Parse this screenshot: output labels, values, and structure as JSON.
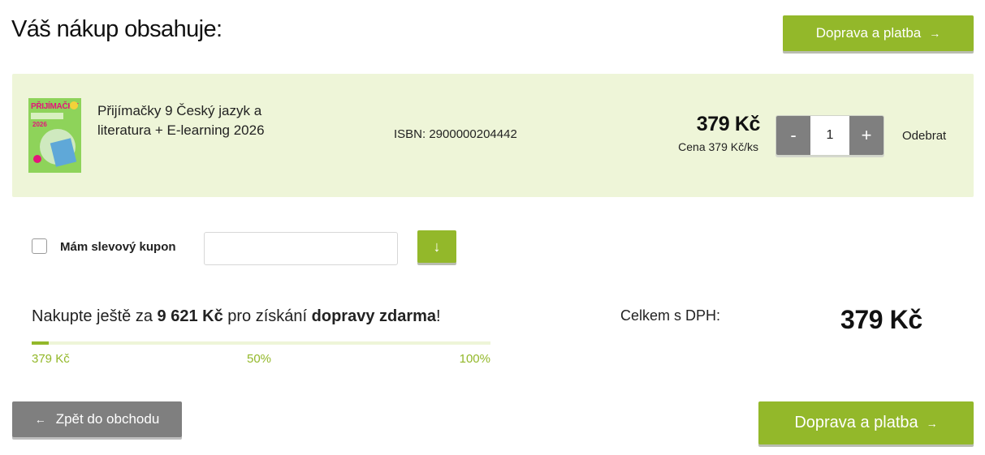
{
  "page": {
    "title": "Váš nákup obsahuje:"
  },
  "actions": {
    "top_cta_label": "Doprava a platba",
    "bottom_cta_label": "Doprava a platba",
    "back_label": "Zpět do obchodu",
    "arrow_right": "→",
    "arrow_left": "←"
  },
  "cart": {
    "items": [
      {
        "name": "Přijímačky 9 Český jazyk a literatura + E-learning 2026",
        "isbn": "ISBN: 2900000204442",
        "price": "379 Kč",
        "unit_price": "Cena 379 Kč/ks",
        "quantity": "1",
        "decrement_label": "-",
        "increment_label": "+",
        "remove_label": "Odebrat",
        "cover_title": "PŘIJÍMAČKY",
        "cover_year": "2026"
      }
    ]
  },
  "coupon": {
    "label": "Mám slevový kupon",
    "checked": false,
    "value": "",
    "placeholder": "",
    "submit_icon": "↓"
  },
  "free_shipping": {
    "prefix": "Nakupte ještě za ",
    "amount": "9 621 Kč",
    "middle": " pro získání ",
    "highlight": "dopravy zdarma",
    "suffix": "!",
    "progress_fraction": 0.0365,
    "label_start": "379 Kč",
    "label_mid": "50%",
    "label_end": "100%"
  },
  "totals": {
    "label": "Celkem s DPH:",
    "value": "379 Kč"
  },
  "colors": {
    "accent": "#93b82a",
    "item_background": "#eef5d8",
    "secondary_button": "#7f7f7f"
  },
  "icons": {
    "top_cta": "arrow-right-icon",
    "bottom_cta": "arrow-right-icon",
    "back": "arrow-left-icon",
    "coupon_submit": "arrow-down-icon"
  }
}
